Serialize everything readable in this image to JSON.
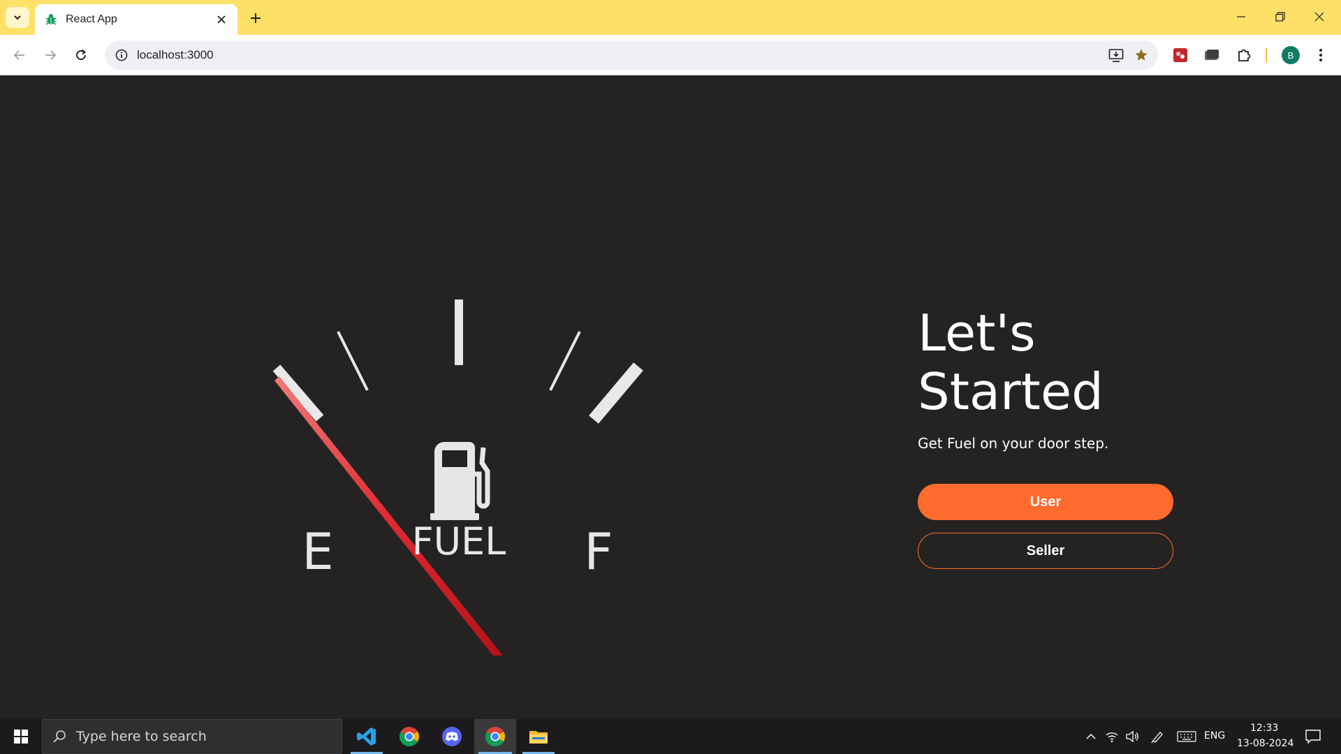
{
  "browser": {
    "tab_title": "React App",
    "url": "localhost:3000",
    "profile_initial": "B"
  },
  "gauge": {
    "label": "FUEL",
    "empty_label": "E",
    "full_label": "F",
    "needle_color": "#d4161c"
  },
  "hero": {
    "title": "Let's Started",
    "subtitle": "Get Fuel on your door step.",
    "user_button": "User",
    "seller_button": "Seller",
    "accent_color": "#ff6b2d"
  },
  "taskbar": {
    "search_placeholder": "Type here to search",
    "language": "ENG",
    "time": "12:33",
    "date": "13-08-2024",
    "apps": [
      "vscode-icon",
      "chrome-icon",
      "discord-icon",
      "chrome-icon",
      "file-explorer-icon"
    ]
  }
}
